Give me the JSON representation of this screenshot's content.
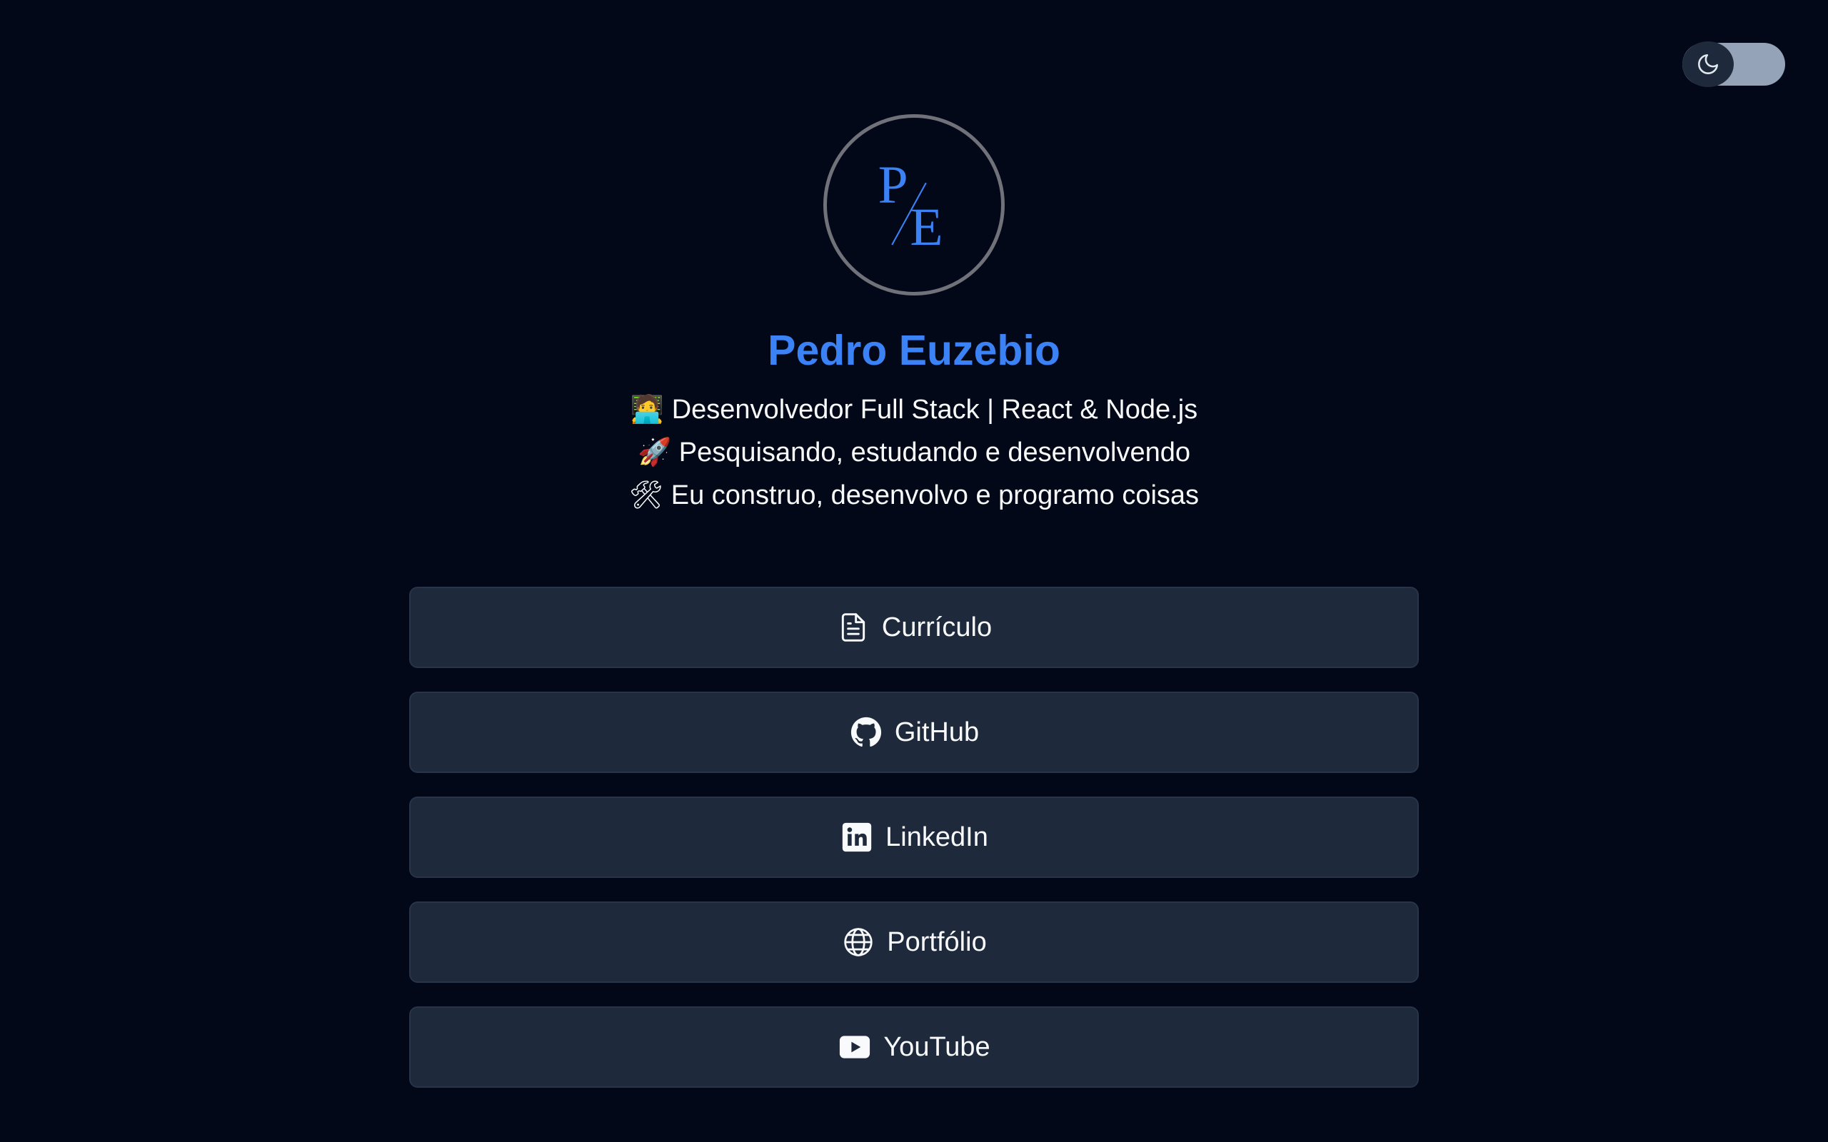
{
  "theme_toggle": {
    "icon": "moon-icon",
    "state": "dark"
  },
  "profile": {
    "avatar_monogram": "P/E",
    "name": "Pedro Euzebio",
    "bio": [
      "🧑‍💻 Desenvolvedor Full Stack | React & Node.js",
      "🚀 Pesquisando, estudando e desenvolvendo",
      "🛠 Eu construo, desenvolvo e programo coisas"
    ]
  },
  "links": [
    {
      "label": "Currículo",
      "icon": "document-icon"
    },
    {
      "label": "GitHub",
      "icon": "github-icon"
    },
    {
      "label": "LinkedIn",
      "icon": "linkedin-icon"
    },
    {
      "label": "Portfólio",
      "icon": "globe-icon"
    },
    {
      "label": "YouTube",
      "icon": "youtube-icon"
    }
  ],
  "colors": {
    "background": "#020817",
    "accent": "#3b82f6",
    "button": "#1e293b",
    "text": "#f8fafc"
  }
}
